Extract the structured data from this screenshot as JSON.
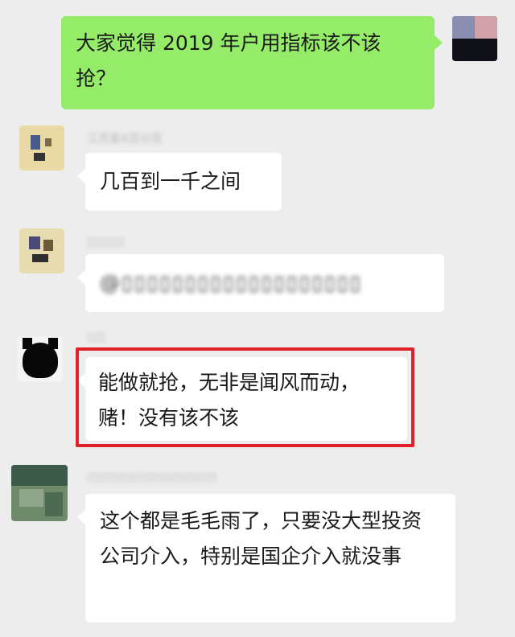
{
  "messages": [
    {
      "sender": "me",
      "text": "大家觉得 2019 年户用指标该不该抢？"
    },
    {
      "sender": "江苏爱X百分百",
      "text": "几百到一千之间"
    },
    {
      "sender": "▯▯▯▯▯▯",
      "text": "@▯▯▯▯▯▯▯▯▯▯▯▯▯▯▯▯▯▯▯"
    },
    {
      "sender": "▯▯▯",
      "text": "能做就抢，无非是闻风而动，赌！没有该不该",
      "highlighted": true
    },
    {
      "sender": "▯▯▯▯▯▯▯▯▯▯▯▯▯▯▯▯▯▯▯▯▯",
      "text": "这个都是毛毛雨了，只要没大型投资公司介入，特别是国企介入就没事"
    }
  ],
  "colors": {
    "background": "#ededed",
    "outgoing_bubble": "#95ec69",
    "incoming_bubble": "#ffffff",
    "highlight": "#e0212a"
  }
}
